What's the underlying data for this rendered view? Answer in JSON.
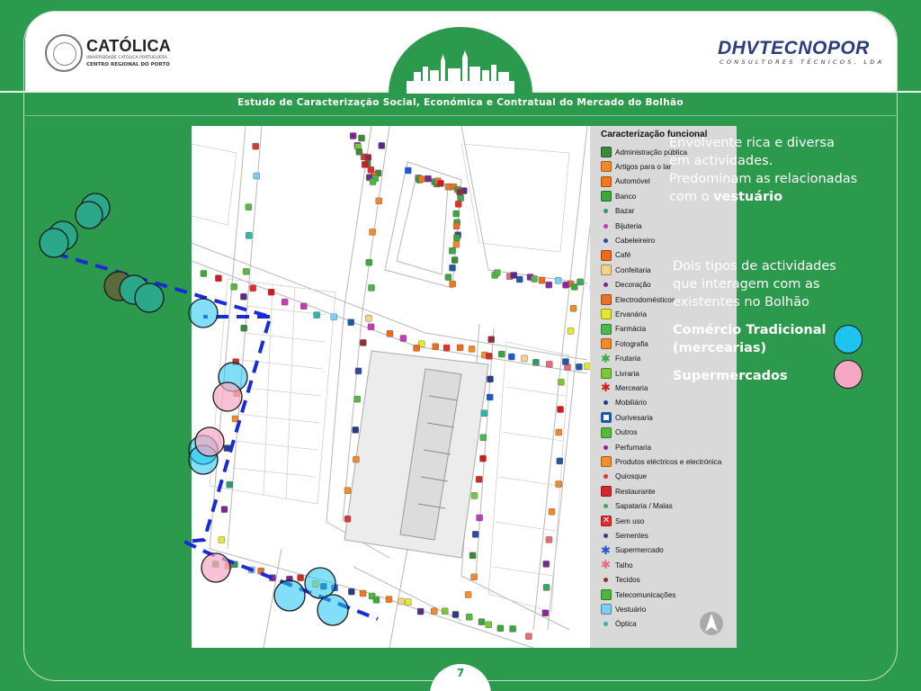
{
  "header": {
    "left_logo": {
      "name": "CATÓLICA",
      "line1": "UNIVERSIDADE CATÓLICA PORTUGUESA",
      "line2": "CENTRO REGIONAL DO PORTO"
    },
    "right_logo": {
      "name": "DHVTECNOPOR",
      "tagline": "CONSULTORES TÉCNICOS, LDA"
    },
    "subtitle": "Estudo de Caracterização Social, Económica e Contratual do Mercado do Bolhão"
  },
  "legend": {
    "title": "Caracterização funcional",
    "items": [
      {
        "label": "Administração pública",
        "kind": "square",
        "color": "#3a8a3a"
      },
      {
        "label": "Artigos para o lar",
        "kind": "square",
        "color": "#f08a2a"
      },
      {
        "label": "Automóvel",
        "kind": "square",
        "color": "#f07a1a"
      },
      {
        "label": "Banco",
        "kind": "square",
        "color": "#3aa83a"
      },
      {
        "label": "Bazar",
        "kind": "dot",
        "color": "#2f9a6a"
      },
      {
        "label": "Bijuteria",
        "kind": "dot",
        "color": "#c43ab8"
      },
      {
        "label": "Cabeleireiro",
        "kind": "dot",
        "color": "#2a4aa8"
      },
      {
        "label": "Café",
        "kind": "square",
        "color": "#f06a1a"
      },
      {
        "label": "Confeitaria",
        "kind": "square",
        "color": "#f4d28a"
      },
      {
        "label": "Decoração",
        "kind": "dot",
        "color": "#7a2a8a"
      },
      {
        "label": "Electrodomésticos",
        "kind": "square",
        "color": "#e8702a"
      },
      {
        "label": "Ervanária",
        "kind": "square",
        "color": "#e8e82a"
      },
      {
        "label": "Farmácia",
        "kind": "square",
        "color": "#4ab84a"
      },
      {
        "label": "Fotografia",
        "kind": "square",
        "color": "#f08a2a"
      },
      {
        "label": "Frutaria",
        "kind": "star",
        "color": "#3aa83a"
      },
      {
        "label": "Livraria",
        "kind": "square",
        "color": "#7ac83a"
      },
      {
        "label": "Mercearia",
        "kind": "star",
        "color": "#d41a1a"
      },
      {
        "label": "Mobiliário",
        "kind": "dot",
        "color": "#2a3a8a"
      },
      {
        "label": "Ourivesaria",
        "kind": "ring",
        "color": "#1a5aa8"
      },
      {
        "label": "Outros",
        "kind": "square",
        "color": "#5ab83a"
      },
      {
        "label": "Perfumaria",
        "kind": "dot",
        "color": "#8a2a9a"
      },
      {
        "label": "Produtos eléctricos e electrónica",
        "kind": "square",
        "color": "#f0902a"
      },
      {
        "label": "Quiosque",
        "kind": "dot",
        "color": "#d43a3a"
      },
      {
        "label": "Restaurante",
        "kind": "square",
        "color": "#d42a2a"
      },
      {
        "label": "Sapataria / Malas",
        "kind": "dot",
        "color": "#3aaa5a"
      },
      {
        "label": "Sem uso",
        "kind": "cross",
        "color": "#e82a2a"
      },
      {
        "label": "Sementes",
        "kind": "dot",
        "color": "#5a2a8a"
      },
      {
        "label": "Supermercado",
        "kind": "star",
        "color": "#1a5ad4"
      },
      {
        "label": "Talho",
        "kind": "star",
        "color": "#e86a7a"
      },
      {
        "label": "Tecidos",
        "kind": "dot",
        "color": "#9a2a3a"
      },
      {
        "label": "Telecomunicações",
        "kind": "square",
        "color": "#4ab83a"
      },
      {
        "label": "Vestuário",
        "kind": "square",
        "color": "#7ad0f0"
      },
      {
        "label": "Óptica",
        "kind": "dot",
        "color": "#2ab8a8"
      }
    ]
  },
  "notes": {
    "n1_text": "Envolvente rica e diversa em actividades. Predominam as relacionadas com o",
    "n1_bold": "vestuário",
    "n2": "Dois tipos de actividades que interagem com as existentes no Bolhão",
    "n3": "Comércio Tradicional (mercearias)",
    "n4": "Supermercados"
  },
  "colors": {
    "background": "#2c9a4c",
    "traditional_marker": "#1ec4f0",
    "supermarket_marker": "#f4a8c4",
    "boundary_line": "#1a2ad4"
  },
  "page_number": "7"
}
